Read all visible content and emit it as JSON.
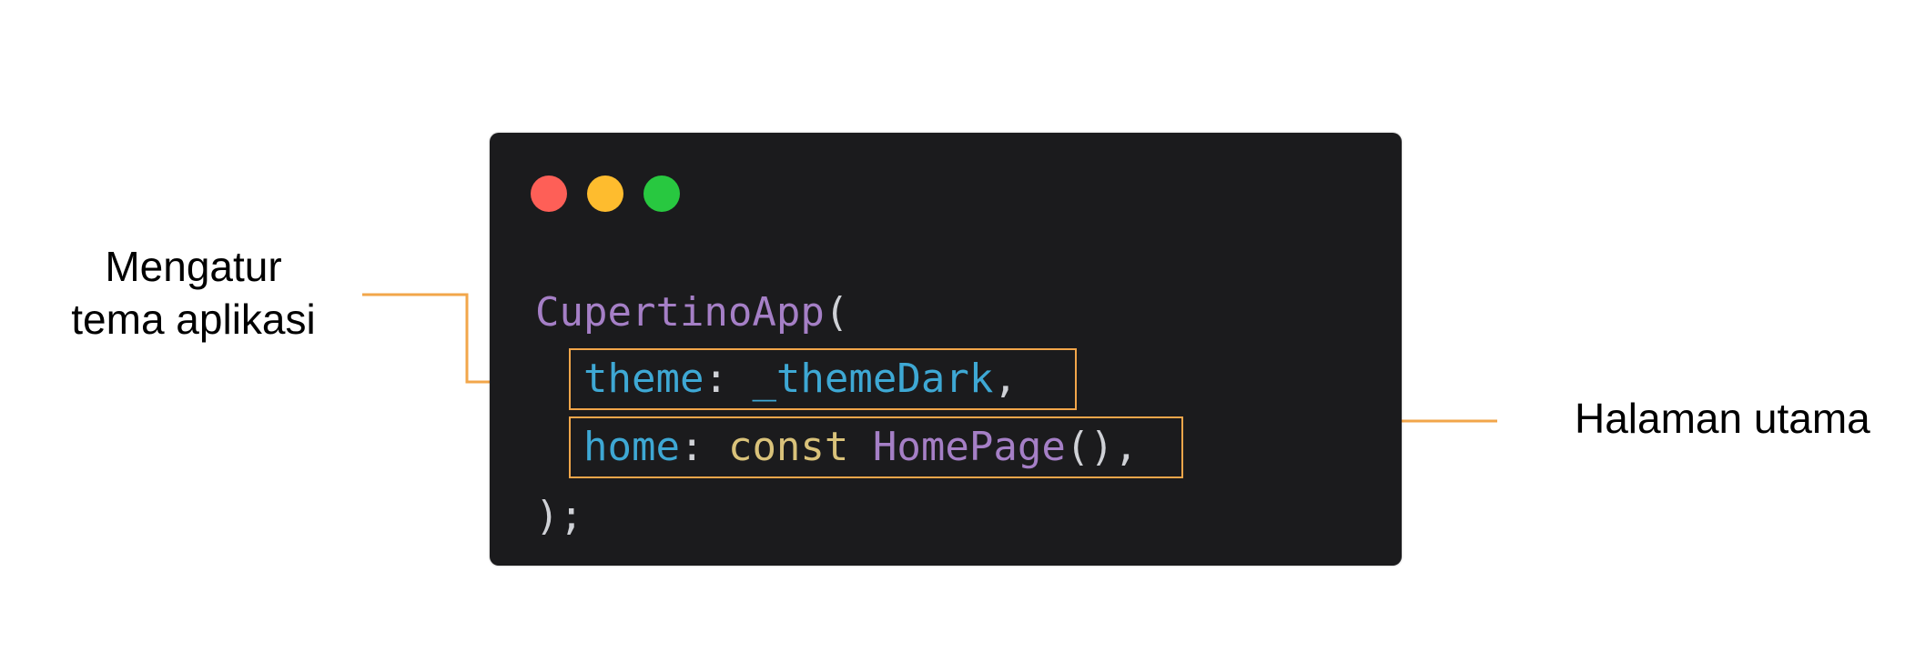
{
  "colors": {
    "window_background": "#1b1b1d",
    "highlight_border": "#f2a64a",
    "connector": "#f2a64a",
    "dot_red": "#fe5f57",
    "dot_yellow": "#febc2e",
    "dot_green": "#28c840",
    "class_name": "#a57fc6",
    "property": "#3ea8d4",
    "keyword": "#d9c27a",
    "punctuation": "#cfd1d6"
  },
  "annotations": {
    "left": {
      "line1": "Mengatur",
      "line2": "tema aplikasi"
    },
    "right": {
      "text": "Halaman utama"
    }
  },
  "code": {
    "line1": {
      "class_name": "CupertinoApp",
      "open_paren": "("
    },
    "line2": {
      "key": "theme",
      "colon": ": ",
      "value": "_themeDark",
      "comma": ","
    },
    "line3": {
      "key": "home",
      "colon": ": ",
      "keyword": "const",
      "space": " ",
      "class_name": "HomePage",
      "call": "()",
      "comma": ","
    },
    "line4": {
      "text": ");"
    }
  }
}
